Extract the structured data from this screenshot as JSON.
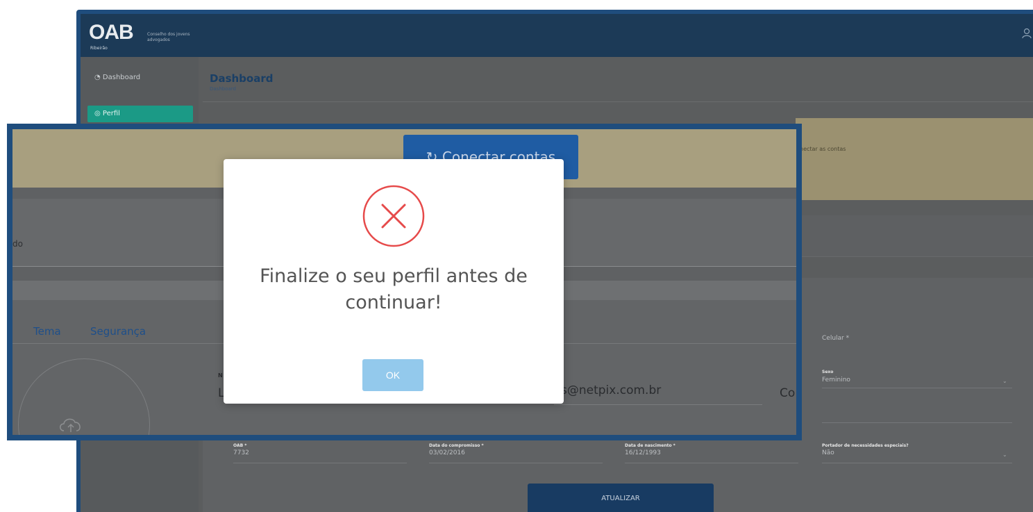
{
  "app": {
    "logo_text": "OAB",
    "logo_sub": "Ribeirão",
    "logo_caption": "Conselho dos jovens advogados"
  },
  "sidebar": {
    "items": [
      {
        "label": "Dashboard",
        "icon": "dashboard-icon"
      },
      {
        "label": "Perfil",
        "icon": "user-icon"
      }
    ]
  },
  "header": {
    "title": "Dashboard",
    "breadcrumb": "Dashboard"
  },
  "banner": {
    "connect_label": "↻ Conectar contas",
    "side_text": "nectar as contas"
  },
  "strip_text": "do",
  "tabs": [
    "Tema",
    "Segurança"
  ],
  "form": {
    "n_label": "N",
    "l_value": "L",
    "email_value": "s@netpix.com.br",
    "co_label": "Co",
    "celular_label": "Celular *",
    "sexo_label": "Sexo",
    "sexo_value": "Feminino",
    "oab_label": "OAB *",
    "oab_value": "7732",
    "compromisso_label": "Data do compromisso *",
    "compromisso_value": "03/02/2016",
    "nascimento_label": "Data de nascimento *",
    "nascimento_value": "16/12/1993",
    "especial_label": "Portador de necessidades especiais?",
    "especial_value": "Não",
    "update_label": "ATUALIZAR"
  },
  "modal": {
    "title": "Finalize o seu perfil antes de continuar!",
    "ok_label": "OK",
    "icon": "error-x-icon",
    "accent_color": "#e64a4a",
    "button_color": "#93c9ec"
  }
}
